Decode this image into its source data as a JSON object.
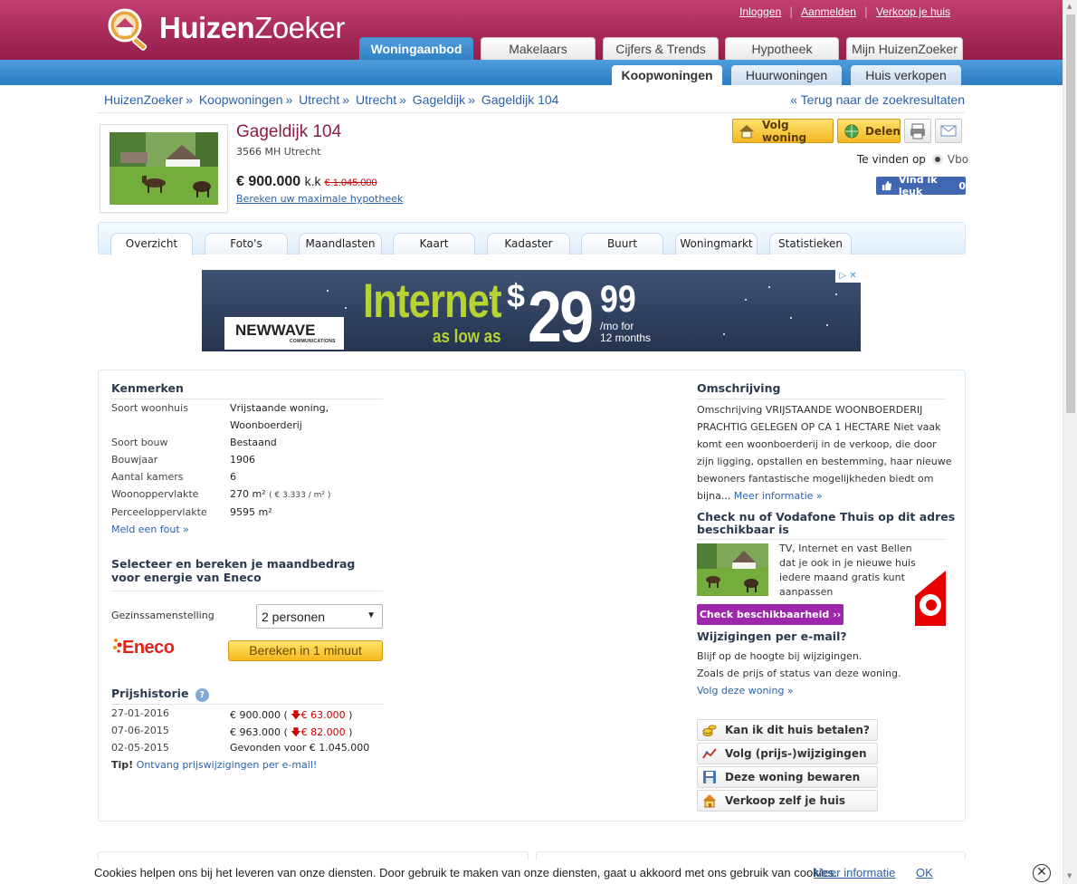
{
  "brand": {
    "name_bold": "Huizen",
    "name_rest": "Zoeker",
    "accent": "#a82b5a",
    "blue": "#2e7fc4"
  },
  "top_links": [
    "Inloggen",
    "Aanmelden",
    "Verkoop je huis"
  ],
  "main_tabs": [
    "Woningaanbod",
    "Makelaars",
    "Cijfers & Trends",
    "Hypotheek",
    "Mijn HuizenZoeker"
  ],
  "sub_tabs": [
    "Koopwoningen",
    "Huurwoningen",
    "Huis verkopen"
  ],
  "breadcrumb": [
    "HuizenZoeker",
    "Koopwoningen",
    "Utrecht",
    "Utrecht",
    "Gageldijk",
    "Gageldijk 104"
  ],
  "breadcrumb_sep": "»",
  "back_link": "« Terug naar de zoekresultaten",
  "property": {
    "title": "Gageldijk 104",
    "postal": "3566 MH Utrecht",
    "price": "€ 900.000",
    "price_suffix": "k.k",
    "old_price": "€ 1.045.000",
    "mortgage_link": "Bereken uw maximale hypotheek"
  },
  "actions": {
    "follow": "Volg woning",
    "share": "Delen",
    "print_icon": "printer-icon",
    "mail_icon": "envelope-icon"
  },
  "find_on": {
    "label": "Te vinden op",
    "source": "Vbo"
  },
  "facebook": {
    "label": "Vind ik leuk",
    "count": "0"
  },
  "detail_tabs": [
    "Overzicht",
    "Foto's",
    "Maandlasten",
    "Kaart",
    "Kadaster",
    "Buurt",
    "Woningmarkt",
    "Statistieken"
  ],
  "ad": {
    "brand": "NEWWAVE",
    "brand_sub": "COMMUNICATIONS",
    "headline": "Internet",
    "subline": "as low as",
    "dollar": "$",
    "price_main": "29",
    "price_cents": "99",
    "permo_1": "/mo for",
    "permo_2": "12 months",
    "choices_icon": "ad-choices-icon"
  },
  "kenmerken": {
    "title": "Kenmerken",
    "rows": [
      {
        "label": "Soort woonhuis",
        "value": "Vrijstaande woning,"
      },
      {
        "label": "",
        "value": "Woonboerderij"
      },
      {
        "label": "Soort bouw",
        "value": "Bestaand"
      },
      {
        "label": "Bouwjaar",
        "value": "1906"
      },
      {
        "label": "Aantal kamers",
        "value": "6"
      },
      {
        "label": "Woonoppervlakte",
        "value": "270 m²",
        "extra": "( € 3.333 / m² )"
      },
      {
        "label": "Perceeloppervlakte",
        "value": "9595 m²"
      }
    ],
    "report_link": "Meld een fout »"
  },
  "energy": {
    "title_1": "Selecteer en bereken je maandbedrag",
    "title_2": "voor energie van Eneco",
    "household_label": "Gezinssamenstelling",
    "household_value": "2 personen",
    "logo": "Eneco",
    "calc_button": "Bereken in 1 minuut"
  },
  "price_history": {
    "title": "Prijshistorie",
    "rows": [
      {
        "date": "27-01-2016",
        "price": "€ 900.000",
        "change": "€ 63.000"
      },
      {
        "date": "07-06-2015",
        "price": "€ 963.000",
        "change": "€ 82.000"
      },
      {
        "date": "02-05-2015",
        "price": "Gevonden voor € 1.045.000",
        "change": ""
      }
    ],
    "tip_label": "Tip!",
    "tip_link": "Ontvang prijswijzigingen per e-mail!"
  },
  "description": {
    "title": "Omschrijving",
    "lines": [
      "Omschrijving VRIJSTAANDE WOONBOERDERIJ",
      "PRACHTIG GELEGEN OP CA 1 HECTARE Niet vaak",
      "komt een woonboerderij in de verkoop, die door",
      "zijn ligging, opstallen en bestemming, haar nieuwe",
      "bewoners fantastische mogelijkheden biedt om",
      "bijna..."
    ],
    "more_link": "Meer informatie »"
  },
  "vodafone": {
    "title_1": "Check nu of Vodafone Thuis op dit adres",
    "title_2": "beschikbaar is",
    "text": [
      "TV, Internet en vast Bellen",
      "dat je ook in je nieuwe huis",
      "iedere maand gratis kunt",
      "aanpassen"
    ],
    "button": "Check beschikbaarheid ››"
  },
  "email_alert": {
    "title": "Wijzigingen per e-mail?",
    "line_1": "Blijf op de hoogte bij wijzigingen.",
    "line_2": "Zoals de prijs of status van deze woning.",
    "link": "Volg deze woning »"
  },
  "side_buttons": [
    {
      "label": "Kan ik dit huis betalen?",
      "icon": "coins-icon"
    },
    {
      "label": "Volg (prijs-)wijzigingen",
      "icon": "chart-icon"
    },
    {
      "label": "Deze woning bewaren",
      "icon": "save-icon"
    },
    {
      "label": "Verkoop zelf je huis",
      "icon": "house-icon"
    }
  ],
  "cookie": {
    "text": "Cookies helpen ons bij het leveren van onze diensten. Door gebruik te maken van onze diensten, gaat u akkoord met ons gebruik van cookies.",
    "more": "Meer informatie",
    "ok": "OK",
    "close": "✕"
  }
}
